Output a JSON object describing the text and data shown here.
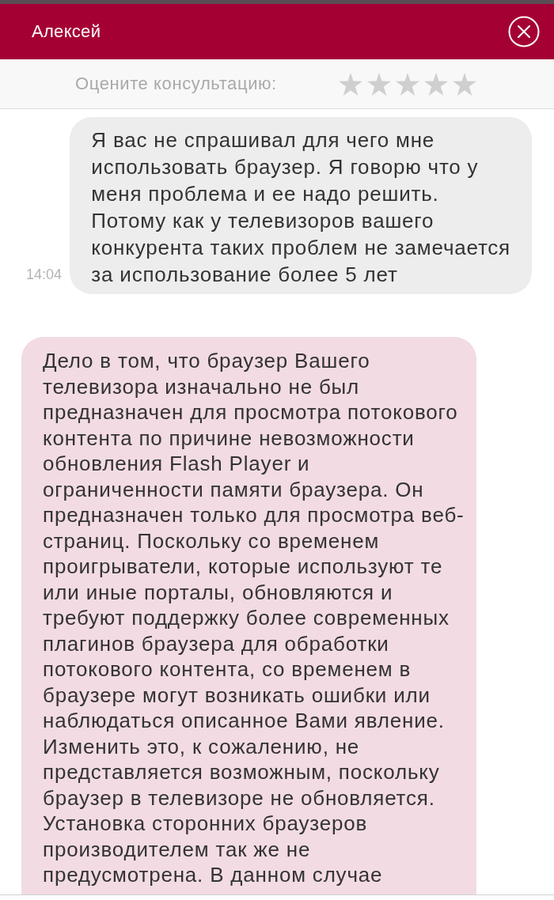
{
  "header": {
    "title": "Алексей"
  },
  "rating": {
    "label": "Оцените консультацию:",
    "stars": 0
  },
  "messages": [
    {
      "kind": "outgoing",
      "time": "14:04",
      "lines": [
        "Я вас не спрашивал для чего мне",
        "использовать браузер. Я говорю что у",
        "меня проблема и ее надо решить.",
        "Потому как у телевизоров вашего",
        "конкурента таких проблем не замечается",
        "за использование более 5 лет"
      ]
    },
    {
      "kind": "incoming",
      "lines": [
        "Дело в том, что браузер Вашего",
        "телевизора изначально не был",
        "предназначен для просмотра потокового",
        "контента по причине невозможности",
        "обновления Flash Player и",
        "ограниченности памяти браузера. Он",
        "предназначен только для просмотра веб-",
        "страниц. Поскольку со временем",
        "проигрыватели, которые используют те",
        "или иные порталы, обновляются и",
        "требуют поддержку более современных",
        "плагинов браузера для обработки",
        "потокового контента, со временем в",
        "браузере могут возникать ошибки или",
        "наблюдаться описанное Вами явление.",
        "Изменить это, к сожалению, не",
        "представляется возможным, поскольку",
        "браузер в телевизоре не обновляется.",
        "Установка сторонних браузеров",
        "производителем так же не",
        "предусмотрена. В данном случае"
      ]
    }
  ]
}
